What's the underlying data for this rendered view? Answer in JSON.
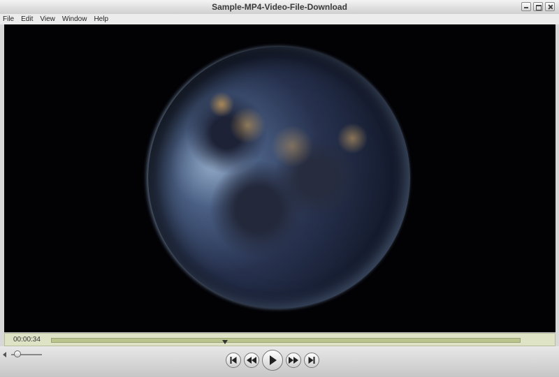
{
  "window": {
    "title": "Sample-MP4-Video-File-Download"
  },
  "menu": {
    "items": [
      "File",
      "Edit",
      "View",
      "Window",
      "Help"
    ]
  },
  "player": {
    "current_time": "00:00:34",
    "progress_fraction": 0.37,
    "volume_fraction": 0.1
  },
  "icons": {
    "minimize": "minimize-icon",
    "maximize": "maximize-icon",
    "close": "close-icon",
    "volume": "volume-icon",
    "go_to_start": "go-to-start-icon",
    "rewind": "rewind-icon",
    "play": "play-icon",
    "fast_forward": "fast-forward-icon",
    "go_to_end": "go-to-end-icon"
  },
  "colors": {
    "timeline_bg": "#dfe3c6",
    "track": "#b9c58d",
    "video_bg": "#020205"
  }
}
